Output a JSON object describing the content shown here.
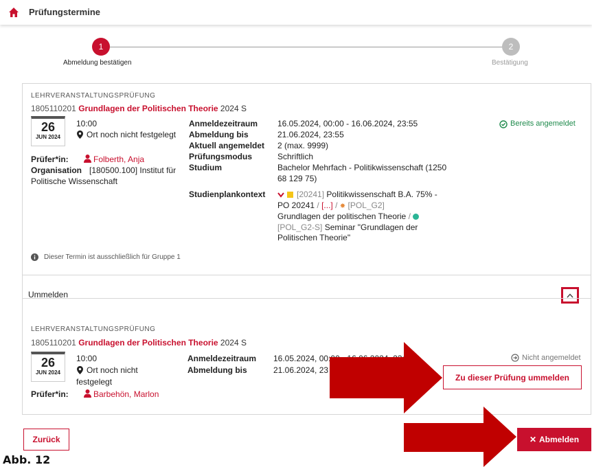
{
  "header": {
    "title": "Prüfungstermine"
  },
  "stepper": {
    "step1": {
      "number": "1",
      "label": "Abmeldung bestätigen"
    },
    "step2": {
      "number": "2",
      "label": "Bestätigung"
    }
  },
  "exam1": {
    "section": "LEHRVERANSTALTUNGSPRÜFUNG",
    "course_number": "1805110201",
    "course_name": "Grundlagen der Politischen Theorie",
    "semester": "2024 S",
    "day": "26",
    "month": "JUN 2024",
    "time": "10:00",
    "location": "Ort noch nicht festgelegt",
    "examiner_label": "Prüfer*in:",
    "examiner": "Folberth, Anja",
    "org_label": "Organisation",
    "org_value_line1": "[180500.100] Institut für",
    "org_value_line2": "Politische Wissenschaft",
    "status": "Bereits angemeldet",
    "details": {
      "anmeldezeitraum_label": "Anmeldezeitraum",
      "anmeldezeitraum": "16.05.2024, 00:00 - 16.06.2024, 23:55",
      "abmeldung_label": "Abmeldung bis",
      "abmeldung": "21.06.2024, 23:55",
      "aktuell_label": "Aktuell angemeldet",
      "aktuell": "2 (max. 9999)",
      "modus_label": "Prüfungsmodus",
      "modus": "Schriftlich",
      "studium_label": "Studium",
      "studium_line1": "Bachelor Mehrfach - Politikwissenschaft (1250",
      "studium_line2": "68 129 75)",
      "kontext_label": "Studienplankontext",
      "kontext_code1": "[20241]",
      "kontext_text1": "Politikwissenschaft B.A. 75% -",
      "kontext_text1b": "PO 20241",
      "kontext_ellipsis": "[...]",
      "kontext_code2": "[POL_G2]",
      "kontext_text2": "Grundlagen der politischen Theorie",
      "kontext_code3": "[POL_G2-S]",
      "kontext_text3": "Seminar \"Grundlagen der",
      "kontext_text3b": "Politischen Theorie\""
    },
    "note": "Dieser Termin ist ausschließlich für Gruppe 1"
  },
  "ummelden": {
    "label": "Ummelden"
  },
  "exam2": {
    "section": "LEHRVERANSTALTUNGSPRÜFUNG",
    "course_number": "1805110201",
    "course_name": "Grundlagen der Politischen Theorie",
    "semester": "2024 S",
    "day": "26",
    "month": "JUN 2024",
    "time": "10:00",
    "location_line1": "Ort noch nicht",
    "location_line2": "festgelegt",
    "examiner_label": "Prüfer*in:",
    "examiner": "Barbehön, Marlon",
    "anmeldezeitraum_label": "Anmeldezeitraum",
    "anmeldezeitraum": "16.05.2024, 00:00 - 16.06.2024, 23:",
    "abmeldung_label": "Abmeldung bis",
    "abmeldung": "21.06.2024, 23",
    "status": "Nicht angemeldet",
    "switch_button": "Zu dieser Prüfung ummelden"
  },
  "footer": {
    "back_button": "Zurück",
    "cancel_button": "Abmelden"
  },
  "caption": "Abb. 12",
  "colors": {
    "accent": "#c8102e",
    "success": "#1f8a4c",
    "annotation_arrow": "#c00000"
  }
}
